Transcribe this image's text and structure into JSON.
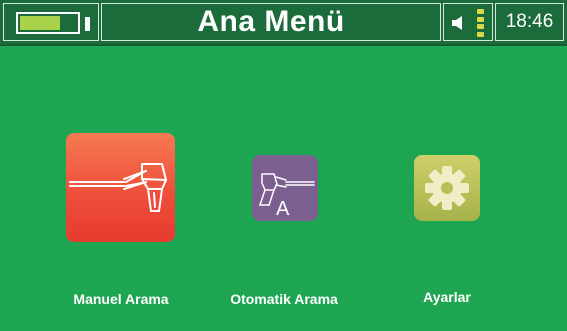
{
  "status_bar": {
    "title": "Ana Menü",
    "time": "18:46",
    "battery_level": 0.72,
    "battery_icon": "battery-icon",
    "sound_icon": "speaker-icon",
    "signal_icon": "signal-bars-icon",
    "signal_bars": 4
  },
  "menu": {
    "items": [
      {
        "label": "Manuel Arama",
        "icon": "detector-icon"
      },
      {
        "label": "Otomatik Arama",
        "icon": "auto-detector-icon",
        "badge": "A"
      },
      {
        "label": "Ayarlar",
        "icon": "gear-icon"
      }
    ]
  },
  "colors": {
    "background": "#1ea552",
    "status_bar": "#1b6b3b",
    "manual_tile": "#ee4f3b",
    "auto_tile": "#7b5f8f",
    "settings_tile": "#a6b24a",
    "accent": "#a7d24a"
  }
}
